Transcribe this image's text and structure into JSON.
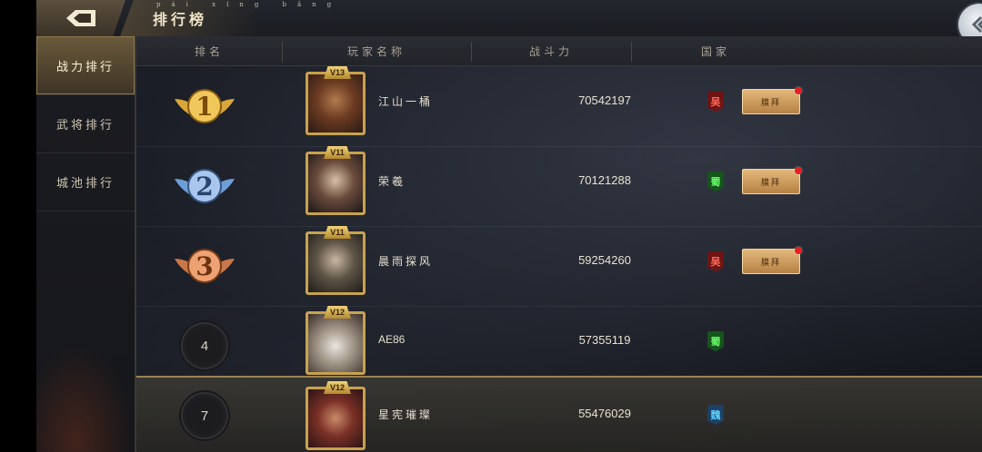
{
  "header": {
    "title": "排行榜",
    "title_pinyin": "pái xíng bǎng",
    "back_icon": "back-arrow-icon",
    "close_icon": "chevron-left-close-icon"
  },
  "sidebar": {
    "tabs": [
      {
        "label": "战力排行",
        "active": true
      },
      {
        "label": "武将排行",
        "active": false
      },
      {
        "label": "城池排行",
        "active": false
      }
    ]
  },
  "table": {
    "headers": [
      "排名",
      "玩家名称",
      "战斗力",
      "国家"
    ],
    "worship_label": "膜拜",
    "rows": [
      {
        "rank": "1",
        "vip": "V13",
        "name": "江山一桶",
        "power": "70542197",
        "nation": "吴",
        "worship": true
      },
      {
        "rank": "2",
        "vip": "V11",
        "name": "荣羲",
        "power": "70121288",
        "nation": "蜀",
        "worship": true
      },
      {
        "rank": "3",
        "vip": "V11",
        "name": "晨雨探风",
        "power": "59254260",
        "nation": "吴",
        "worship": true
      },
      {
        "rank": "4",
        "vip": "V12",
        "name": "AE86",
        "power": "57355119",
        "nation": "蜀",
        "worship": false
      },
      {
        "rank": "7",
        "vip": "V12",
        "name": "星宪璀璨",
        "power": "55476029",
        "nation": "魏",
        "worship": false
      }
    ]
  },
  "colors": {
    "gold": "#c8a24e",
    "wu": "#6e1414",
    "shu": "#15541b",
    "wei": "#1c3f63"
  }
}
